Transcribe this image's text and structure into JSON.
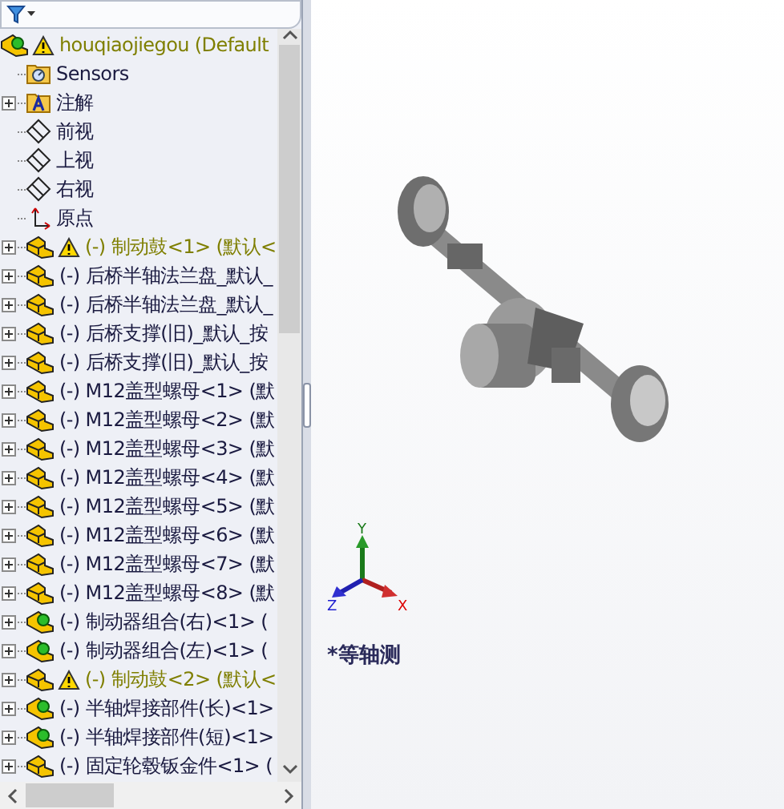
{
  "tree": {
    "root": {
      "label": "houqiaojiegou  (Default",
      "warning": true,
      "kind": "assembly"
    },
    "items": [
      {
        "label": "Sensors",
        "kind": "sensors",
        "expandable": false,
        "warning": false
      },
      {
        "label": "注解",
        "kind": "annotation",
        "expandable": true,
        "warning": false
      },
      {
        "label": "前视",
        "kind": "plane",
        "expandable": false,
        "warning": false
      },
      {
        "label": "上视",
        "kind": "plane",
        "expandable": false,
        "warning": false
      },
      {
        "label": "右视",
        "kind": "plane",
        "expandable": false,
        "warning": false
      },
      {
        "label": "原点",
        "kind": "origin",
        "expandable": false,
        "warning": false
      },
      {
        "label": "(-) 制动鼓<1> (默认<",
        "kind": "part",
        "expandable": true,
        "warning": true
      },
      {
        "label": "(-) 后桥半轴法兰盘_默认_",
        "kind": "part",
        "expandable": true,
        "warning": false
      },
      {
        "label": "(-) 后桥半轴法兰盘_默认_",
        "kind": "part",
        "expandable": true,
        "warning": false
      },
      {
        "label": "(-) 后桥支撑(旧)_默认_按",
        "kind": "part",
        "expandable": true,
        "warning": false
      },
      {
        "label": "(-) 后桥支撑(旧)_默认_按",
        "kind": "part",
        "expandable": true,
        "warning": false
      },
      {
        "label": "(-) M12盖型螺母<1> (默",
        "kind": "part",
        "expandable": true,
        "warning": false
      },
      {
        "label": "(-) M12盖型螺母<2> (默",
        "kind": "part",
        "expandable": true,
        "warning": false
      },
      {
        "label": "(-) M12盖型螺母<3> (默",
        "kind": "part",
        "expandable": true,
        "warning": false
      },
      {
        "label": "(-) M12盖型螺母<4> (默",
        "kind": "part",
        "expandable": true,
        "warning": false
      },
      {
        "label": "(-) M12盖型螺母<5> (默",
        "kind": "part",
        "expandable": true,
        "warning": false
      },
      {
        "label": "(-) M12盖型螺母<6> (默",
        "kind": "part",
        "expandable": true,
        "warning": false
      },
      {
        "label": "(-) M12盖型螺母<7> (默",
        "kind": "part",
        "expandable": true,
        "warning": false
      },
      {
        "label": "(-) M12盖型螺母<8> (默",
        "kind": "part",
        "expandable": true,
        "warning": false
      },
      {
        "label": "(-) 制动器组合(右)<1> (",
        "kind": "assembly",
        "expandable": true,
        "warning": false
      },
      {
        "label": "(-) 制动器组合(左)<1> (",
        "kind": "assembly",
        "expandable": true,
        "warning": false
      },
      {
        "label": "(-) 制动鼓<2> (默认<",
        "kind": "part",
        "expandable": true,
        "warning": true
      },
      {
        "label": "(-) 半轴焊接部件(长)<1>",
        "kind": "assembly",
        "expandable": true,
        "warning": false
      },
      {
        "label": "(-) 半轴焊接部件(短)<1>",
        "kind": "assembly",
        "expandable": true,
        "warning": false
      },
      {
        "label": "(-) 固定轮毂钣金件<1> (",
        "kind": "part",
        "expandable": true,
        "warning": false
      }
    ]
  },
  "viewport": {
    "view_label": "*等轴测",
    "axes": [
      "Y",
      "Z",
      "X"
    ]
  }
}
